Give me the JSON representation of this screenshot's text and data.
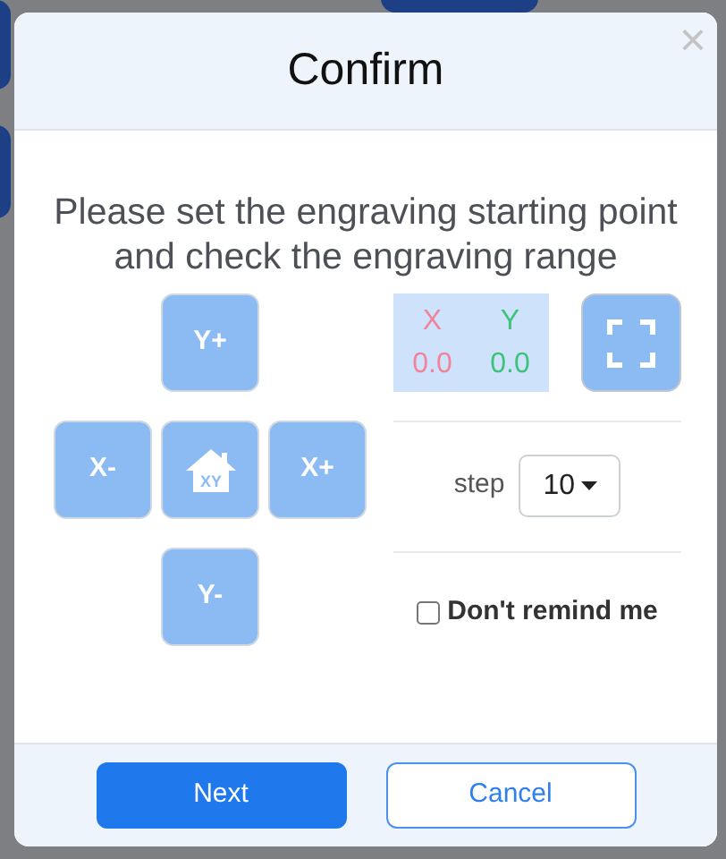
{
  "dialog": {
    "title": "Confirm",
    "close": "×",
    "message": "Please set the engraving starting point and check the engraving range"
  },
  "jog_buttons": [
    {
      "label": "Y+",
      "kind": "label"
    },
    {
      "label": "X-",
      "kind": "label"
    },
    {
      "kind": "home",
      "label": "XY"
    },
    {
      "label": "X+",
      "kind": "label"
    },
    {
      "label": "Y-",
      "kind": "label"
    }
  ],
  "coordinates": [
    {
      "axis": "X",
      "value": "0.0",
      "color": "#f0849b"
    },
    {
      "axis": "Y",
      "value": "0.0",
      "color": "#3ec47a"
    }
  ],
  "step": {
    "label": "step",
    "value": "10"
  },
  "remind_checkbox": {
    "label": "Don't remind me",
    "checked": false
  },
  "buttons": [
    {
      "label": "Next",
      "kind": "primary"
    },
    {
      "label": "Cancel",
      "kind": "outline"
    }
  ]
}
